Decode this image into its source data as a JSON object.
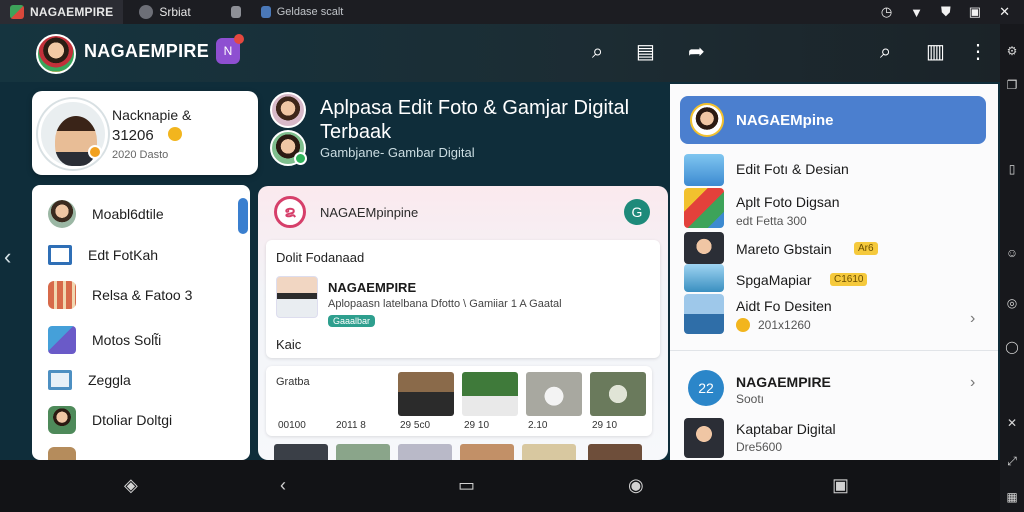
{
  "system_bar": {
    "tabs": [
      {
        "label": "NAGAEMPIRE",
        "icon": "app-logo-icon"
      },
      {
        "label": "Srbiat",
        "icon": "profile-icon"
      },
      {
        "label": "",
        "icon": "page-icon"
      },
      {
        "label": "Geldase scalt",
        "icon": "edit-icon"
      }
    ],
    "status_icons": [
      "clock-icon",
      "wifi-icon",
      "shield-icon",
      "window-icon",
      "close-icon"
    ]
  },
  "header": {
    "title": "NAGAEMPIRE",
    "badge": "N",
    "actions": [
      "search-icon",
      "document-icon",
      "share-icon",
      "search-icon",
      "clipboard-icon",
      "more-icon"
    ]
  },
  "profile": {
    "name": "Nacknapie &",
    "points": "31206",
    "date": "2020 Dasto"
  },
  "hero": {
    "title": "Aplpasa Edit Foto & Gamjar Digital Terbaak",
    "subtitle": "Gambjane- Gambar Digital"
  },
  "menu": {
    "items": [
      {
        "label": "Moabl6dtile",
        "icon": "profile-photo-icon",
        "color": "#9bb7a4"
      },
      {
        "label": "Edt FotKah",
        "icon": "frame-icon",
        "color": "#2f6fb6"
      },
      {
        "label": "Relsa & Fatoo 3",
        "icon": "grid-icon",
        "color": "#d76a4a"
      },
      {
        "label": "Motos Solt̃i",
        "icon": "tool-icon",
        "color": "#6a5ac8"
      },
      {
        "label": "Zeggla",
        "icon": "image-icon",
        "color": "#4c8fc2"
      },
      {
        "label": "Dtoliar Doltgi",
        "icon": "person-icon",
        "color": "#4e8a5a"
      },
      {
        "label": "",
        "icon": "thumbnail-icon",
        "color": "#b58c5c"
      }
    ]
  },
  "center": {
    "title": "NAGAEMpinpine",
    "logo_letter": "ຂ",
    "badge_letter": "G",
    "post": {
      "label": "Dolit Fodanaad",
      "title": "NAGAEMPIRE",
      "desc": "Aplopaasn latelbana Dfotto \\ Gamiiar 1 A Gaatal",
      "tag": "Gaaalbar",
      "footer": "Kaic"
    },
    "gallery": {
      "label": "Gratba",
      "captions": [
        "00100",
        "2011 8",
        "29 5c0",
        "29 10",
        "2.10",
        "29 10"
      ],
      "colors": [
        "#7b5a3c",
        "#3f7a3a",
        "#a8a8a0",
        "#6a7a5c"
      ]
    },
    "strip_colors": [
      "#3a3f47",
      "#8aa58a",
      "#b9b9c8",
      "#c29067",
      "#d8c8a0",
      "#6e4e3a"
    ]
  },
  "right_panel": {
    "header_title": "NAGAEMpine",
    "items": [
      {
        "title": "Edit Fotı & Desian",
        "color": "#3d8ad1"
      },
      {
        "title": "Aplt Foto Digsan",
        "sub": "edt Fetta 300",
        "color": "#e3413b"
      },
      {
        "title": "Mareto Gbstain",
        "pill": "Ar6",
        "color": "#2b2e36"
      },
      {
        "title": "SpgaMapiar",
        "pill": "C1610",
        "color": "#3a8fc0"
      },
      {
        "title": "Aidt Fo Desiten",
        "sub": "201x1260",
        "color": "#2f6ea8"
      }
    ],
    "section": {
      "title": "NAGAEMPIRE",
      "sub": "Sootı",
      "icon_text": "22"
    },
    "bottom_item": {
      "title": "Kaptabar Digital",
      "sub": "Dre5600"
    }
  },
  "rail_icons": [
    "settings-icon",
    "copy-icon",
    "device-icon",
    "smile-icon",
    "location-icon",
    "chat-icon",
    "x-icon",
    "expand-icon",
    "grid-icon"
  ],
  "nav_icons": [
    "location-icon",
    "back-icon",
    "home-icon",
    "recent-icon",
    "screenshot-icon"
  ]
}
